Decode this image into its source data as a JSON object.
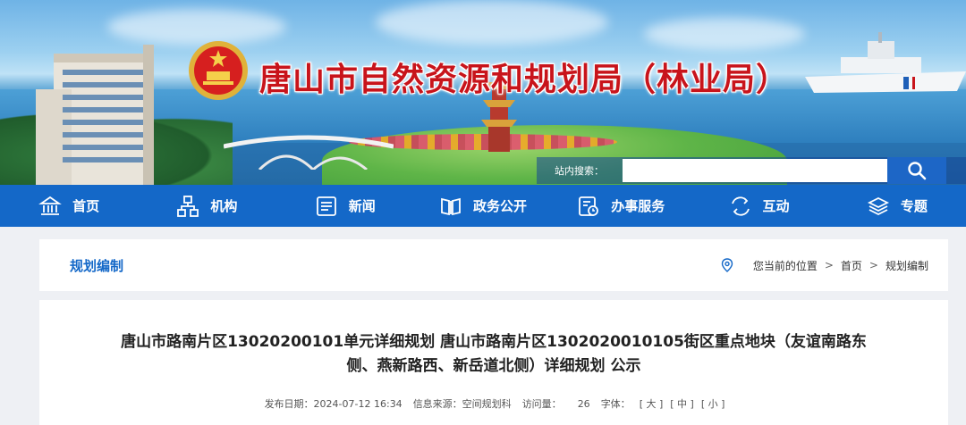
{
  "header": {
    "site_title": "唐山市自然资源和规划局（林业局）",
    "search_label": "站内搜索：",
    "search_placeholder": ""
  },
  "nav": {
    "items": [
      {
        "label": "首页",
        "icon": "bank-icon"
      },
      {
        "label": "机构",
        "icon": "org-chart-icon"
      },
      {
        "label": "新闻",
        "icon": "news-icon"
      },
      {
        "label": "政务公开",
        "icon": "open-book-icon"
      },
      {
        "label": "办事服务",
        "icon": "service-clock-icon"
      },
      {
        "label": "互动",
        "icon": "interaction-icon"
      },
      {
        "label": "专题",
        "icon": "layers-icon"
      }
    ]
  },
  "breadcrumb": {
    "section_title": "规划编制",
    "location_label": "您当前的位置",
    "sep": ">",
    "home": "首页",
    "current": "规划编制"
  },
  "article": {
    "title_line1": "唐山市路南片区13020200101单元详细规划 唐山市路南片区1302020010105街区重点地块（友谊南路东",
    "title_line2": "侧、燕新路西、新岳道北侧）详细规划 公示",
    "meta": {
      "date": "发布日期：2024-07-12 16:34",
      "source": "信息来源：空间规划科",
      "views_label": "访问量：",
      "views": "26",
      "fontsize_label": "字体：",
      "font_large": "[ 大 ]",
      "font_medium": "[ 中 ]",
      "font_small": "[ 小 ]"
    }
  },
  "colors": {
    "nav_bg": "#1468c8",
    "title_red": "#c8141b",
    "accent_blue": "#1468c8"
  }
}
